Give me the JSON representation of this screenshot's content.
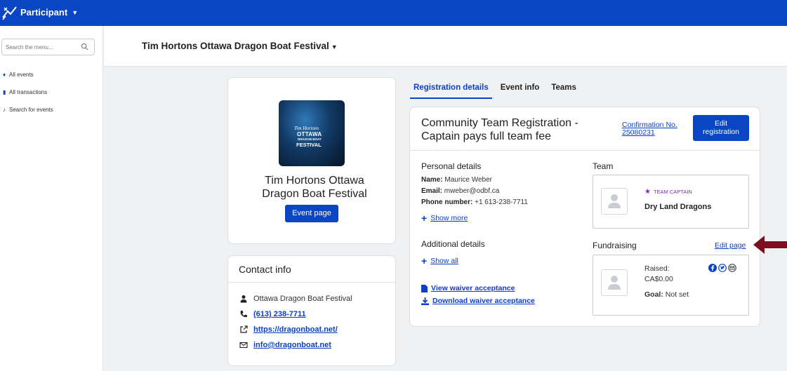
{
  "topbar": {
    "role_label": "Participant"
  },
  "sidebar": {
    "search_placeholder": "Search the menu...",
    "items": [
      {
        "label": "All events",
        "icon": "event-icon"
      },
      {
        "label": "All transactions",
        "icon": "transactions-icon"
      },
      {
        "label": "Search for events",
        "icon": "search-events-icon"
      }
    ]
  },
  "header": {
    "event_title": "Tim Hortons Ottawa Dragon Boat Festival"
  },
  "event_card": {
    "logo_text": {
      "brand": "Tim Hortons",
      "line1": "OTTAWA",
      "line2": "DRAGON BOAT",
      "line3": "FESTIVAL"
    },
    "name_line1": "Tim Hortons Ottawa",
    "name_line2": "Dragon Boat Festival",
    "button": "Event page"
  },
  "contact": {
    "title": "Contact info",
    "organization": "Ottawa Dragon Boat Festival",
    "phone": "(613) 238-7711",
    "website": "https://dragonboat.net/",
    "email": "info@dragonboat.net"
  },
  "tabs": [
    {
      "label": "Registration details",
      "active": true
    },
    {
      "label": "Event info",
      "active": false
    },
    {
      "label": "Teams",
      "active": false
    }
  ],
  "registration": {
    "title": "Community Team Registration - Captain pays full team fee",
    "confirmation_line1": "Confirmation No.",
    "confirmation_line2": "25080231",
    "edit_line1": "Edit",
    "edit_line2": "registration",
    "personal_title": "Personal details",
    "name_label": "Name:",
    "name_value": "Maurice Weber",
    "email_label": "Email:",
    "email_value": "mweber@odbf.ca",
    "phone_label": "Phone number:",
    "phone_value": "+1 613-238-7711",
    "show_more": "Show more",
    "additional_title": "Additional details",
    "show_all": "Show all",
    "view_waiver": "View waiver acceptance",
    "download_waiver": "Download waiver acceptance",
    "team_title": "Team",
    "captain_badge": "TEAM CAPTAIN",
    "team_name": "Dry Land Dragons",
    "fundraising_title": "Fundraising",
    "edit_page": "Edit page",
    "raised_label": "Raised:",
    "raised_value": "CA$0.00",
    "goal_label": "Goal:",
    "goal_value": "Not set"
  },
  "colors": {
    "brand_blue": "#0a45c4",
    "link_blue": "#0b3fc4",
    "captain_purple": "#7a2bb5",
    "arrow_red": "#7d1020"
  }
}
